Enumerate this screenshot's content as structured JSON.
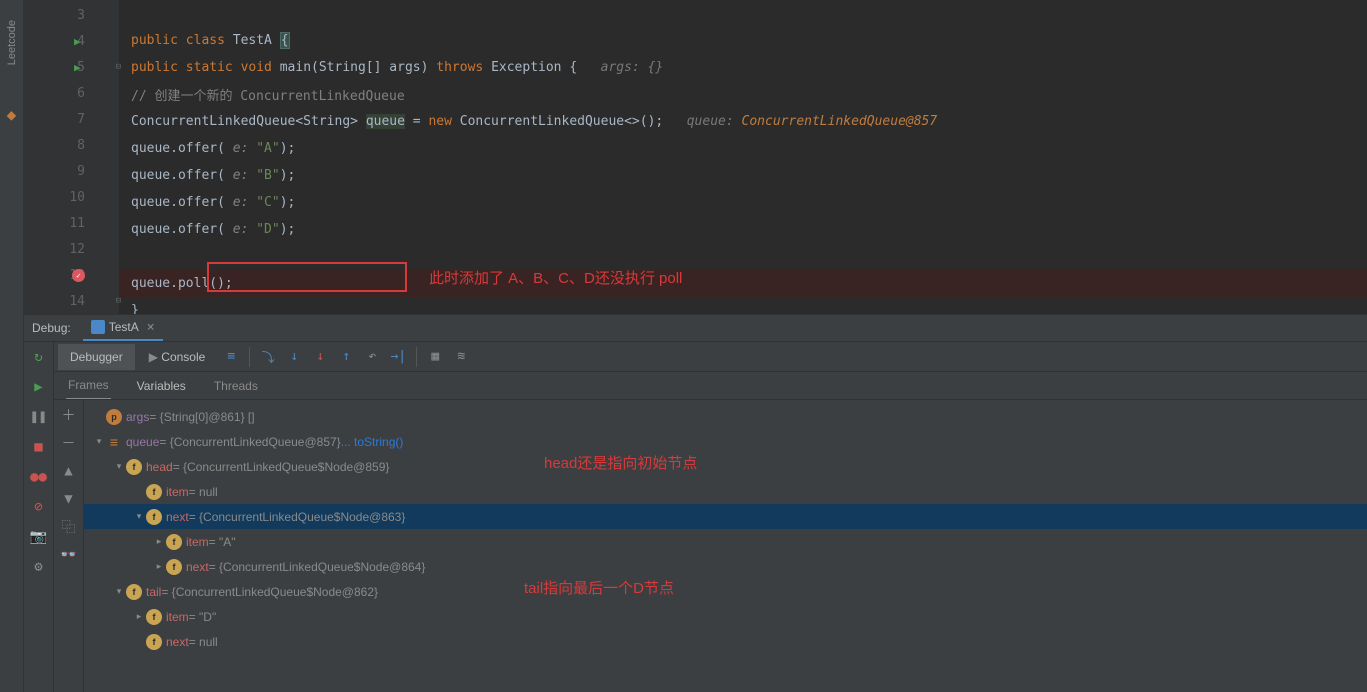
{
  "sidebar": {
    "leetcode": "Leetcode"
  },
  "editor": {
    "lines": [
      {
        "num": 3,
        "html": ""
      },
      {
        "num": 4,
        "run": true,
        "html": "<span class='kw'>public class </span><span class='cls'>TestA </span><span class='brace-hl'>{</span>"
      },
      {
        "num": 5,
        "run": true,
        "fold": true,
        "html": "    <span class='kw'>public static void </span><span class='cls'>main(</span><span class='cls'>String[] args) </span><span class='kw'>throws </span><span class='cls'>Exception {   </span><span class='hint'>args: {}</span>"
      },
      {
        "num": 6,
        "html": "        <span class='cmt'>// 创建一个新的 ConcurrentLinkedQueue</span>"
      },
      {
        "num": 7,
        "html": "        <span class='cls'>ConcurrentLinkedQueue&lt;String&gt; </span><span class='ident-hl'>queue</span><span class='cls'> = </span><span class='kw'>new </span><span class='cls'>ConcurrentLinkedQueue&lt;&gt;();   </span><span class='hint'>queue: </span><span class='hint-orange'>ConcurrentLinkedQueue@857</span>"
      },
      {
        "num": 8,
        "html": "        <span class='cls'>queue.offer( </span><span class='param'>e: </span><span class='str'>\"A\"</span><span class='cls'>);</span>"
      },
      {
        "num": 9,
        "html": "        <span class='cls'>queue.offer( </span><span class='param'>e: </span><span class='str'>\"B\"</span><span class='cls'>);</span>"
      },
      {
        "num": 10,
        "html": "        <span class='cls'>queue.offer( </span><span class='param'>e: </span><span class='str'>\"C\"</span><span class='cls'>);</span>"
      },
      {
        "num": 11,
        "html": "        <span class='cls'>queue.offer( </span><span class='param'>e: </span><span class='str'>\"D\"</span><span class='cls'>);</span>"
      },
      {
        "num": 12,
        "html": ""
      },
      {
        "num": 13,
        "bp": true,
        "html": "        <span class='cls'>queue.poll();</span>"
      },
      {
        "num": 14,
        "fold": true,
        "html": "    <span class='cls'>}</span>"
      }
    ],
    "annotations": {
      "comment1": "此时添加了 A、B、C、D还没执行 poll"
    }
  },
  "debug": {
    "title": "Debug:",
    "tab": "TestA",
    "toolbar": {
      "debugger": "Debugger",
      "console": "Console"
    },
    "subtabs": {
      "frames": "Frames",
      "variables": "Variables",
      "threads": "Threads"
    },
    "annotations": {
      "head": "head还是指向初始节点",
      "tail": "tail指向最后一个D节点"
    },
    "vars": [
      {
        "ind": 1,
        "chev": "",
        "badge": "p",
        "name": "args",
        "val": " = {String[0]@861} []"
      },
      {
        "ind": 1,
        "chev": "v",
        "badge": "eq",
        "name": "queue",
        "val": " = {ConcurrentLinkedQueue@857} ",
        "link": "... toString()"
      },
      {
        "ind": 2,
        "chev": "v",
        "badge": "f",
        "name": "head",
        "nameClass": "red",
        "val": " = {ConcurrentLinkedQueue$Node@859}"
      },
      {
        "ind": 3,
        "chev": "",
        "badge": "f",
        "name": "item",
        "nameClass": "red",
        "val": " = null"
      },
      {
        "ind": 3,
        "chev": "v",
        "badge": "f",
        "name": "next",
        "nameClass": "red",
        "val": " = {ConcurrentLinkedQueue$Node@863}",
        "selected": true
      },
      {
        "ind": 4,
        "chev": ">",
        "badge": "f",
        "name": "item",
        "nameClass": "red",
        "val": " = \"A\""
      },
      {
        "ind": 4,
        "chev": ">",
        "badge": "f",
        "name": "next",
        "nameClass": "red",
        "val": " = {ConcurrentLinkedQueue$Node@864}"
      },
      {
        "ind": 2,
        "chev": "v",
        "badge": "f",
        "name": "tail",
        "nameClass": "red",
        "val": " = {ConcurrentLinkedQueue$Node@862}"
      },
      {
        "ind": 3,
        "chev": ">",
        "badge": "f",
        "name": "item",
        "nameClass": "red",
        "val": " = \"D\""
      },
      {
        "ind": 3,
        "chev": "",
        "badge": "f",
        "name": "next",
        "nameClass": "red",
        "val": " = null"
      }
    ]
  }
}
